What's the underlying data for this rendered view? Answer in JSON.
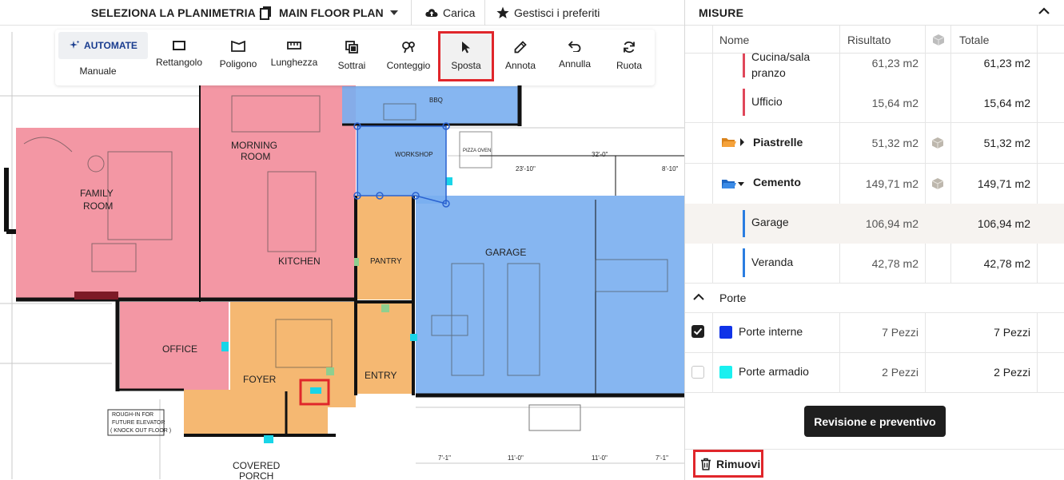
{
  "topbar": {
    "select_label": "SELEZIONA LA PLANIMETRIA :",
    "plan_name": "MAIN FLOOR PLAN",
    "upload_label": "Carica",
    "favorites_label": "Gestisci i preferiti"
  },
  "toolbar": {
    "automate_label": "AUTOMATE",
    "manual_label": "Manuale",
    "tools": [
      {
        "label": "Rettangolo",
        "icon": "rectangle-icon"
      },
      {
        "label": "Poligono",
        "icon": "polygon-icon"
      },
      {
        "label": "Lunghezza",
        "icon": "ruler-icon"
      },
      {
        "label": "Sottrai",
        "icon": "subtract-icon"
      },
      {
        "label": "Conteggio",
        "icon": "count-icon"
      },
      {
        "label": "Sposta",
        "icon": "cursor-icon",
        "active": true
      },
      {
        "label": "Annota",
        "icon": "pen-icon"
      },
      {
        "label": "Annulla",
        "icon": "undo-icon"
      },
      {
        "label": "Ruota",
        "icon": "rotate-icon"
      }
    ]
  },
  "floorplan": {
    "labels": {
      "family_room_1": "FAMILY",
      "family_room_2": "ROOM",
      "morning_room_1": "MORNING",
      "morning_room_2": "ROOM",
      "kitchen": "KITCHEN",
      "pantry": "PANTRY",
      "workshop": "WORKSHOP",
      "garage": "GARAGE",
      "office": "OFFICE",
      "foyer": "FOYER",
      "entry": "ENTRY",
      "covered_1": "COVERED",
      "covered_2": "PORCH",
      "bbq": "BBQ",
      "pizza": "PIZZA OVEN",
      "elevator_1": "ROUGH-IN FOR",
      "elevator_2": "FUTURE ELEVATOR",
      "elevator_3": "( KNOCK OUT FLOOR )",
      "dim_1": "32'-0\"",
      "dim_2": "23'-10\"",
      "dim_3": "8'-10\"",
      "dim_4": "7'-1\"",
      "dim_5": "11'-0\"",
      "dim_6": "11'-0\"",
      "dim_7": "7'-1\""
    },
    "colors": {
      "pink": "#f28c9a",
      "blue": "#79aef0",
      "orange": "#f4b46a",
      "cyan": "#19d5e8"
    }
  },
  "panel": {
    "title": "MISURE",
    "columns": {
      "name": "Nome",
      "result": "Risultato",
      "total": "Totale"
    },
    "rows": [
      {
        "name": "Cucina/sala pranzo",
        "name_line1": "Cucina/sala",
        "name_line2": "pranzo",
        "result": "61,23 m2",
        "total": "61,23 m2",
        "color": "#e0475a"
      },
      {
        "name": "Ufficio",
        "result": "15,64 m2",
        "total": "15,64 m2",
        "color": "#e0475a"
      },
      {
        "name": "Piastrelle",
        "result": "51,32 m2",
        "total": "51,32 m2",
        "folder_color": "#f59a2a"
      },
      {
        "name": "Cemento",
        "result": "149,71 m2",
        "total": "149,71 m2",
        "folder_color": "#2a7de1"
      },
      {
        "name": "Garage",
        "result": "106,94 m2",
        "total": "106,94 m2",
        "color": "#2a7de1"
      },
      {
        "name": "Veranda",
        "result": "42,78 m2",
        "total": "42,78 m2",
        "color": "#2a7de1"
      }
    ],
    "section": {
      "title": "Porte"
    },
    "doors": [
      {
        "name": "Porte interne",
        "result": "7 Pezzi",
        "total": "7 Pezzi",
        "checked": true,
        "color": "#1033e8"
      },
      {
        "name": "Porte armadio",
        "result": "2 Pezzi",
        "total": "2 Pezzi",
        "checked": false,
        "color": "#19f0f0"
      }
    ],
    "review_button": "Revisione e preventivo",
    "remove_button": "Rimuovi"
  }
}
